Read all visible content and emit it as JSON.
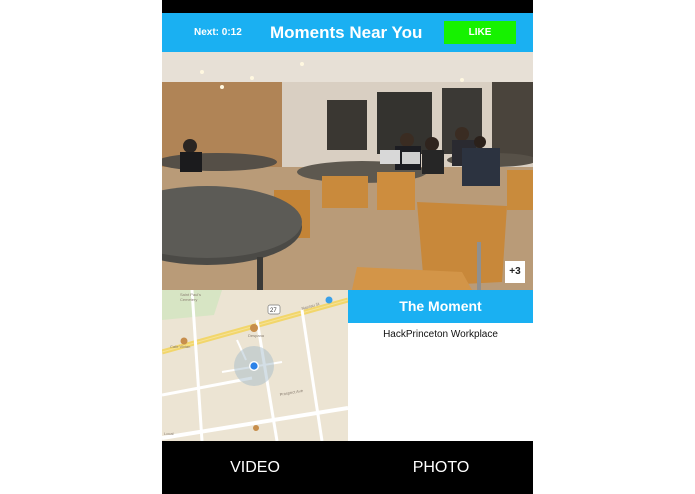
{
  "header": {
    "next_label": "Next: 0:12",
    "title": "Moments Near You",
    "like_label": "LIKE"
  },
  "photo": {
    "extra_count_label": "+3"
  },
  "map": {
    "street_labels": [
      "Nassau St",
      "Nassau St",
      "Prospect Ave",
      "Olden St",
      "Chambers St",
      "Cafe Vivian",
      "Saint Paul's Cemetery",
      "27"
    ],
    "poi_labels": [
      "Despana",
      "Cafe Vivian",
      "Local"
    ]
  },
  "moment": {
    "heading": "The Moment",
    "description": "HackPrinceton Workplace"
  },
  "bottom_bar": {
    "video_label": "VIDEO",
    "photo_label": "PHOTO"
  },
  "colors": {
    "header_blue": "#1ab0f2",
    "like_green": "#16f200",
    "bar_black": "#000000"
  }
}
